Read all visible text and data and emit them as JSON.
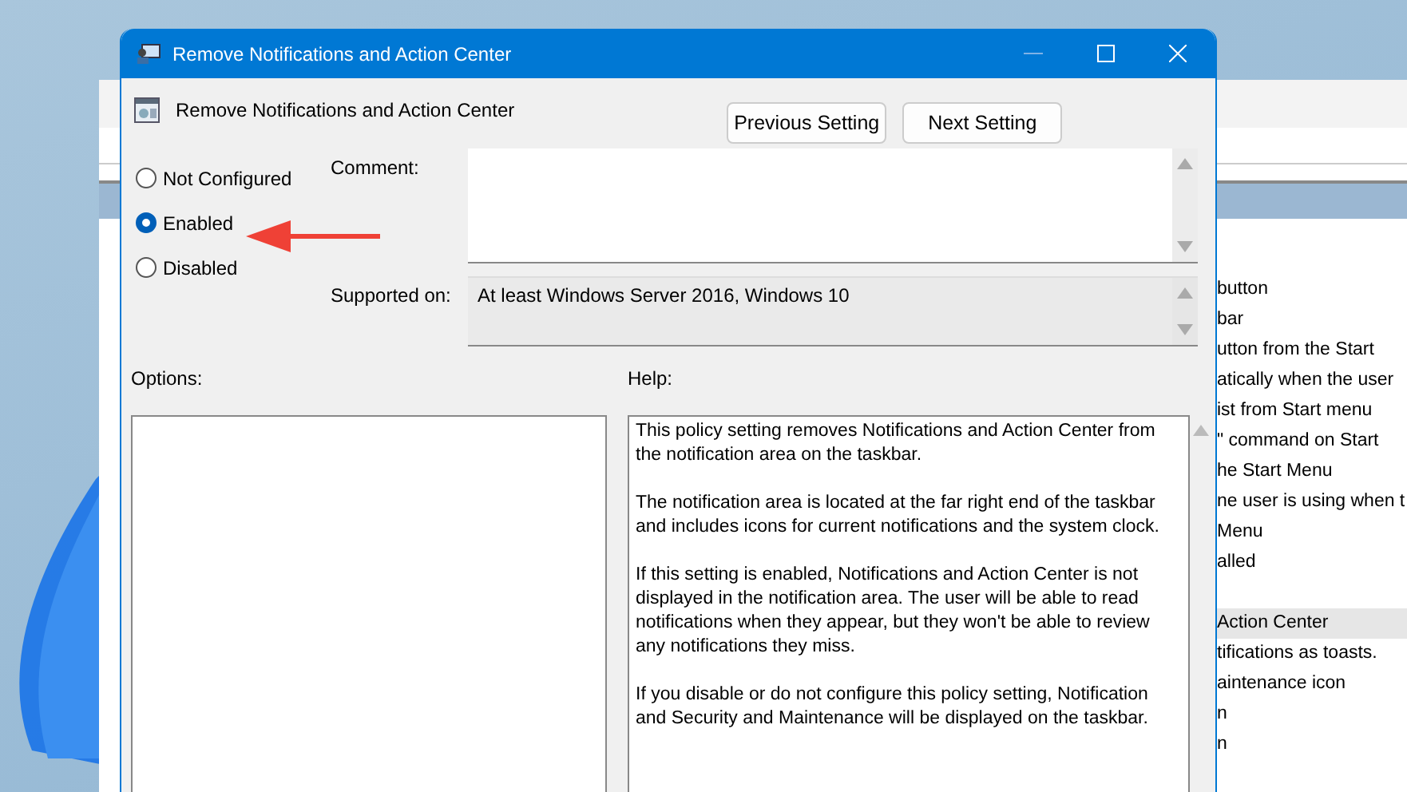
{
  "window": {
    "title": "Remove Notifications and Action Center",
    "policy_name": "Remove Notifications and Action Center",
    "buttons": [
      "Previous Setting",
      "Next Setting"
    ]
  },
  "state_options": [
    {
      "label": "Not Configured",
      "selected": false
    },
    {
      "label": "Enabled",
      "selected": true
    },
    {
      "label": "Disabled",
      "selected": false
    }
  ],
  "comment": {
    "label": "Comment:"
  },
  "supported_on": {
    "label": "Supported on:",
    "value": "At least Windows Server 2016, Windows 10"
  },
  "options": {
    "label": "Options:"
  },
  "help": {
    "label": "Help:",
    "paragraphs": [
      "This policy setting removes Notifications and Action Center from the notification area on the taskbar.",
      "The notification area is located at the far right end of the taskbar and includes icons for current notifications and the system clock.",
      "If this setting is enabled, Notifications and Action Center is not displayed in the notification area. The user will be able to read notifications when they appear, but they won't be able to review any notifications they miss.",
      "If you disable or do not configure this policy setting, Notification and Security and Maintenance will be displayed on the taskbar."
    ]
  },
  "background_window": {
    "items": [
      {
        "text": "button",
        "selected": false
      },
      {
        "text": "bar",
        "selected": false
      },
      {
        "text": "utton from the Start",
        "selected": false
      },
      {
        "text": "atically when the user",
        "selected": false
      },
      {
        "text": "ist from Start menu",
        "selected": false
      },
      {
        "text": "\" command on Start",
        "selected": false
      },
      {
        "text": "he Start Menu",
        "selected": false
      },
      {
        "text": "ne user is using when t",
        "selected": false
      },
      {
        "text": "Menu",
        "selected": false
      },
      {
        "text": "alled",
        "selected": false
      },
      {
        "text": "Action Center",
        "selected": true
      },
      {
        "text": "tifications as toasts.",
        "selected": false
      },
      {
        "text": "aintenance icon",
        "selected": false
      },
      {
        "text": "n",
        "selected": false
      },
      {
        "text": "n",
        "selected": false
      }
    ]
  }
}
